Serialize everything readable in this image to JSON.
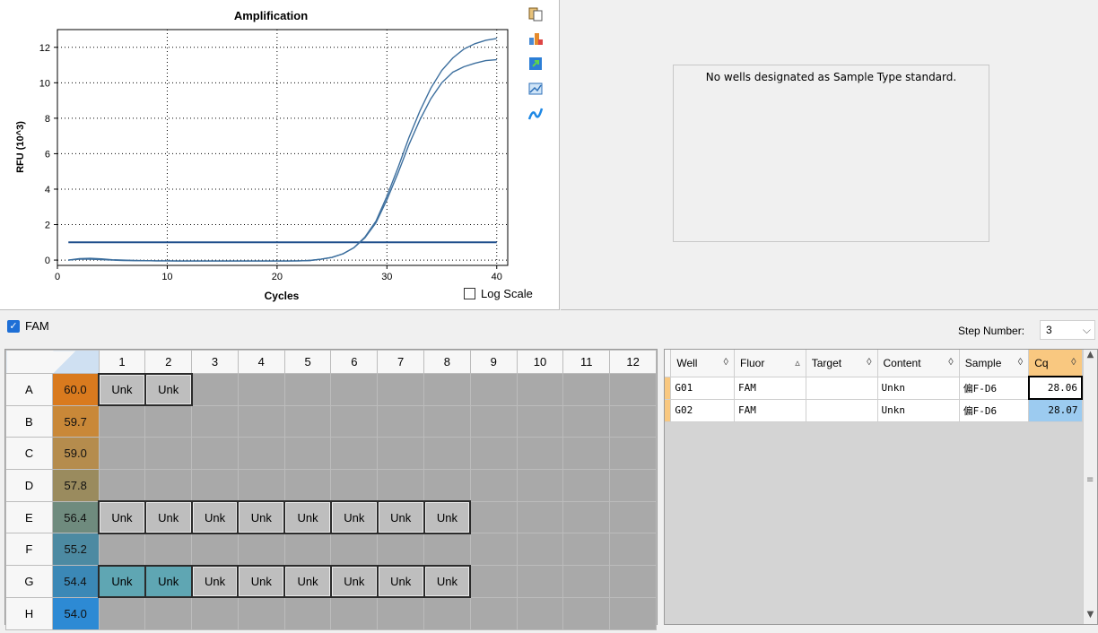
{
  "chart_data": {
    "type": "line",
    "title": "Amplification",
    "xlabel": "Cycles",
    "ylabel": "RFU (10^3)",
    "xlim": [
      0,
      41
    ],
    "ylim": [
      -0.3,
      13
    ],
    "x_ticks": [
      0,
      10,
      20,
      30,
      40
    ],
    "y_ticks": [
      0,
      2,
      4,
      6,
      8,
      10,
      12
    ],
    "grid": true,
    "threshold": 1.0,
    "series": [
      {
        "x": [
          1,
          2,
          3,
          4,
          5,
          6,
          7,
          8,
          9,
          10,
          11,
          12,
          13,
          14,
          15,
          16,
          17,
          18,
          19,
          20,
          21,
          22,
          23,
          24,
          25,
          26,
          27,
          28,
          29,
          30,
          31,
          32,
          33,
          34,
          35,
          36,
          37,
          38,
          39,
          40
        ],
        "y": [
          0,
          0.05,
          0.05,
          0.03,
          0.0,
          -0.02,
          -0.03,
          -0.03,
          -0.04,
          -0.04,
          -0.05,
          -0.05,
          -0.05,
          -0.05,
          -0.05,
          -0.05,
          -0.05,
          -0.05,
          -0.05,
          -0.05,
          -0.05,
          -0.04,
          -0.02,
          0.05,
          0.15,
          0.35,
          0.7,
          1.3,
          2.2,
          3.6,
          5.2,
          6.9,
          8.4,
          9.7,
          10.7,
          11.4,
          11.9,
          12.2,
          12.4,
          12.5
        ]
      },
      {
        "x": [
          1,
          2,
          3,
          4,
          5,
          6,
          7,
          8,
          9,
          10,
          11,
          12,
          13,
          14,
          15,
          16,
          17,
          18,
          19,
          20,
          21,
          22,
          23,
          24,
          25,
          26,
          27,
          28,
          29,
          30,
          31,
          32,
          33,
          34,
          35,
          36,
          37,
          38,
          39,
          40
        ],
        "y": [
          0,
          0.08,
          0.1,
          0.07,
          0.02,
          0.0,
          -0.02,
          -0.03,
          -0.04,
          -0.04,
          -0.05,
          -0.05,
          -0.05,
          -0.05,
          -0.05,
          -0.05,
          -0.05,
          -0.05,
          -0.05,
          -0.05,
          -0.05,
          -0.04,
          -0.02,
          0.05,
          0.15,
          0.35,
          0.7,
          1.25,
          2.1,
          3.4,
          4.9,
          6.5,
          7.9,
          9.1,
          10.0,
          10.6,
          10.9,
          11.1,
          11.25,
          11.3
        ]
      }
    ]
  },
  "chart_panel": {
    "log_scale_label": "Log Scale",
    "log_scale_checked": false
  },
  "toolbar": {
    "icons": [
      "copy-icon",
      "export-icon",
      "refresh-icon",
      "chart-options-icon",
      "analysis-icon"
    ]
  },
  "standard_panel": {
    "message": "No wells designated as Sample Type standard."
  },
  "fluor_bar": {
    "fluor_label": "FAM",
    "fluor_checked": true,
    "step_label": "Step Number:",
    "step_value": "3"
  },
  "plate": {
    "columns": [
      "1",
      "2",
      "3",
      "4",
      "5",
      "6",
      "7",
      "8",
      "9",
      "10",
      "11",
      "12"
    ],
    "rows": [
      {
        "label": "A",
        "temp": "60.0",
        "temp_color": "#d97a1e",
        "wells": [
          "Unk",
          "Unk",
          "",
          "",
          "",
          "",
          "",
          "",
          "",
          "",
          "",
          ""
        ]
      },
      {
        "label": "B",
        "temp": "59.7",
        "temp_color": "#c98838",
        "wells": [
          "",
          "",
          "",
          "",
          "",
          "",
          "",
          "",
          "",
          "",
          "",
          ""
        ]
      },
      {
        "label": "C",
        "temp": "59.0",
        "temp_color": "#b58c4d",
        "wells": [
          "",
          "",
          "",
          "",
          "",
          "",
          "",
          "",
          "",
          "",
          "",
          ""
        ]
      },
      {
        "label": "D",
        "temp": "57.8",
        "temp_color": "#9a8b5e",
        "wells": [
          "",
          "",
          "",
          "",
          "",
          "",
          "",
          "",
          "",
          "",
          "",
          ""
        ]
      },
      {
        "label": "E",
        "temp": "56.4",
        "temp_color": "#6f8b7e",
        "wells": [
          "Unk",
          "Unk",
          "Unk",
          "Unk",
          "Unk",
          "Unk",
          "Unk",
          "Unk",
          "",
          "",
          "",
          ""
        ]
      },
      {
        "label": "F",
        "temp": "55.2",
        "temp_color": "#4c8aa2",
        "wells": [
          "",
          "",
          "",
          "",
          "",
          "",
          "",
          "",
          "",
          "",
          "",
          ""
        ]
      },
      {
        "label": "G",
        "temp": "54.4",
        "temp_color": "#3b88b6",
        "wells": [
          "Unk",
          "Unk",
          "Unk",
          "Unk",
          "Unk",
          "Unk",
          "Unk",
          "Unk",
          "",
          "",
          "",
          ""
        ]
      },
      {
        "label": "H",
        "temp": "54.0",
        "temp_color": "#2d8ad4",
        "wells": [
          "",
          "",
          "",
          "",
          "",
          "",
          "",
          "",
          "",
          "",
          "",
          ""
        ]
      }
    ]
  },
  "well_list": {
    "headers": [
      "Well",
      "Fluor",
      "Target",
      "Content",
      "Sample",
      "Cq"
    ],
    "rows": [
      {
        "well": "G01",
        "fluor": "FAM",
        "target": "",
        "content": "Unkn",
        "sample": "偏F-D6",
        "cq": "28.06"
      },
      {
        "well": "G02",
        "fluor": "FAM",
        "target": "",
        "content": "Unkn",
        "sample": "偏F-D6",
        "cq": "28.07"
      }
    ]
  }
}
